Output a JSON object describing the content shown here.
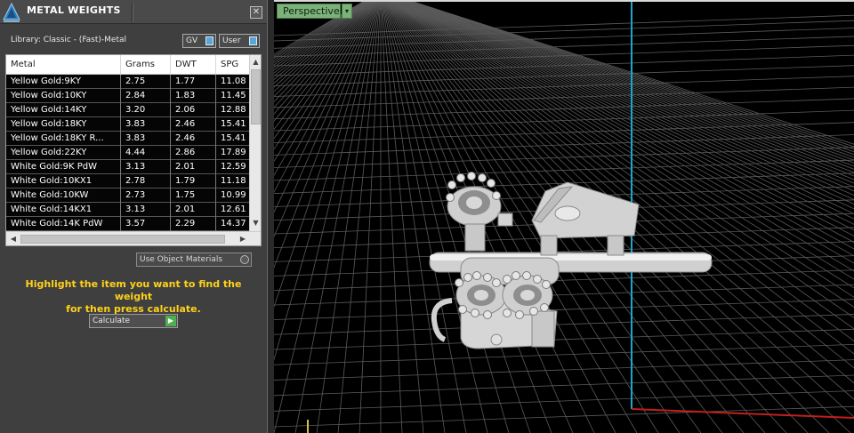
{
  "panel": {
    "title": "METAL WEIGHTS",
    "close_glyph": "✕",
    "library_label": "Library: Classic - (Fast)-Metal",
    "gv_label": "GV",
    "user_label": "User",
    "use_object_materials": "Use Object Materials",
    "instruction_line1": "Highlight the item you want to find the weight",
    "instruction_line2": "for then press calculate.",
    "calculate_label": "Calculate"
  },
  "table": {
    "headers": [
      "Metal",
      "Grams",
      "DWT",
      "SPG"
    ],
    "rows": [
      [
        "Yellow Gold:9KY",
        "2.75",
        "1.77",
        "11.08"
      ],
      [
        "Yellow Gold:10KY",
        "2.84",
        "1.83",
        "11.45"
      ],
      [
        "Yellow Gold:14KY",
        "3.20",
        "2.06",
        "12.88"
      ],
      [
        "Yellow Gold:18KY",
        "3.83",
        "2.46",
        "15.41"
      ],
      [
        "Yellow Gold:18KY R...",
        "3.83",
        "2.46",
        "15.41"
      ],
      [
        "Yellow Gold:22KY",
        "4.44",
        "2.86",
        "17.89"
      ],
      [
        "White Gold:9K PdW",
        "3.13",
        "2.01",
        "12.59"
      ],
      [
        "White Gold:10KX1",
        "2.78",
        "1.79",
        "11.18"
      ],
      [
        "White Gold:10KW",
        "2.73",
        "1.75",
        "10.99"
      ],
      [
        "White Gold:14KX1",
        "3.13",
        "2.01",
        "12.61"
      ],
      [
        "White Gold:14K PdW",
        "3.57",
        "2.29",
        "14.37"
      ]
    ]
  },
  "viewport": {
    "view_name": "Perspective",
    "view_dropdown_glyph": "▾",
    "axis_colors": {
      "x": "#c0201e",
      "z": "#1aa7c8"
    },
    "grid_color": "#5a5a5a",
    "model_color": "#d8d8d8"
  }
}
